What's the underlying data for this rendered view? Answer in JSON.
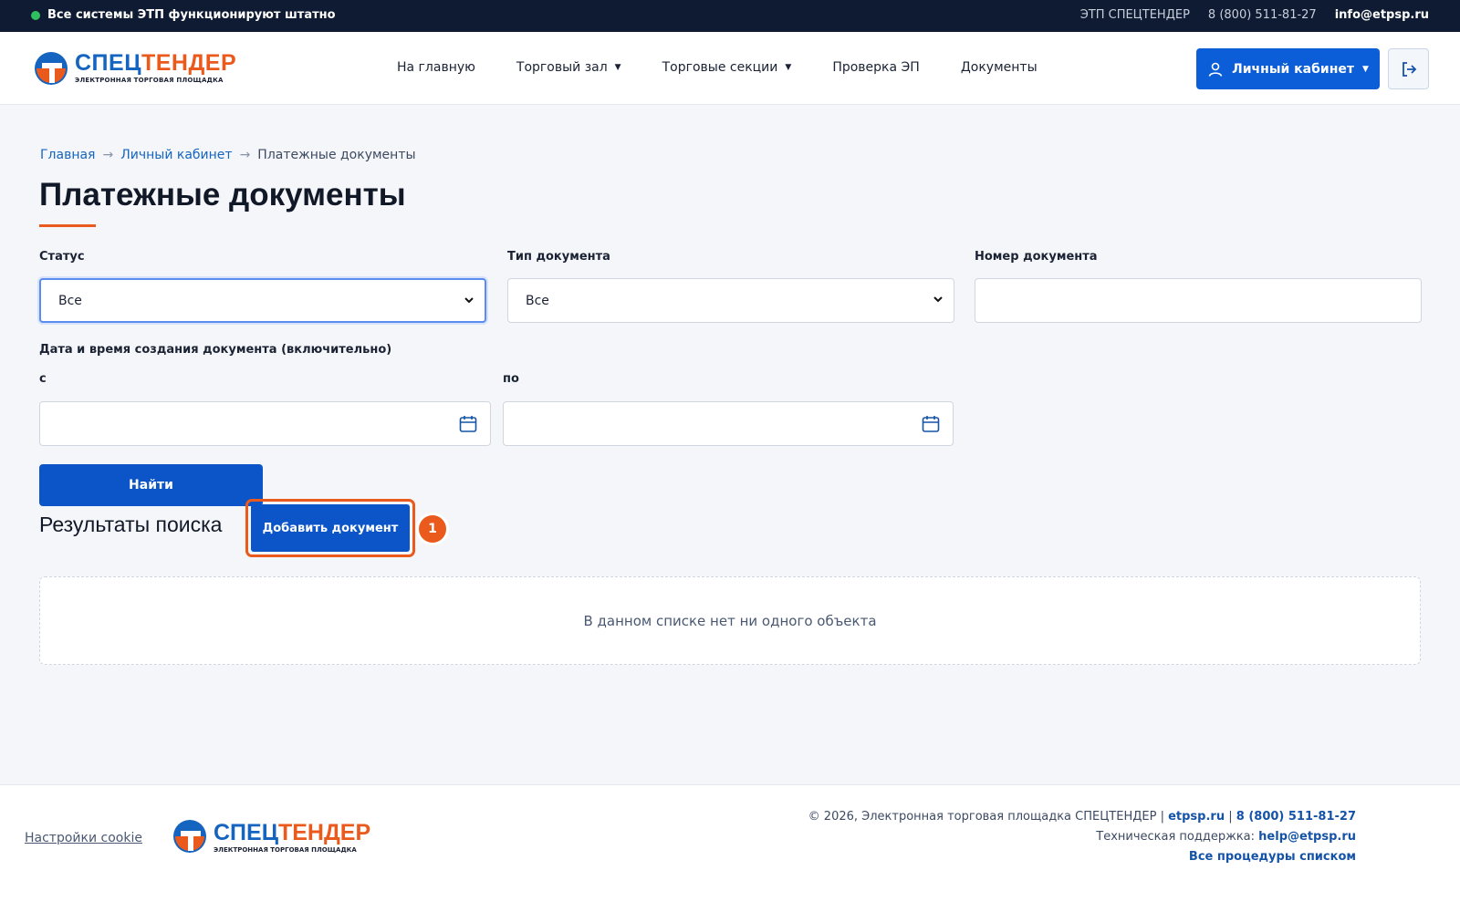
{
  "topbar": {
    "status": "Все системы ЭТП функционируют штатно",
    "brand": "ЭТП СПЕЦТЕНДЕР",
    "phone": "8 (800) 511-81-27",
    "email": "info@etpsp.ru"
  },
  "header": {
    "logo_part1": "СПЕЦ",
    "logo_part2": "ТЕНДЕР",
    "logo_tagline": "ЭЛЕКТРОННАЯ ТОРГОВАЯ ПЛОЩАДКА",
    "nav": [
      {
        "label": "На главную"
      },
      {
        "label": "Торговый зал"
      },
      {
        "label": "Торговые секции"
      },
      {
        "label": "Проверка ЭП"
      },
      {
        "label": "Документы"
      }
    ],
    "cabinet_label": "Личный кабинет"
  },
  "breadcrumbs": [
    "Главная",
    "Личный кабинет",
    "Платежные документы"
  ],
  "page_title": "Платежные документы",
  "filters": {
    "status_label": "Статус",
    "status_value": "Все",
    "doc_type_label": "Тип документа",
    "doc_type_value": "Все",
    "doc_number_label": "Номер документа",
    "doc_number_value": "",
    "date_group_label": "Дата и время создания документа (включительно)",
    "date_from_label": "с",
    "date_to_label": "по",
    "date_from_value": "",
    "date_to_value": "",
    "find_label": "Найти"
  },
  "results": {
    "title": "Результаты поиска",
    "add_label": "Добавить документ",
    "marker": "1",
    "empty_text": "В данном списке нет ни одного объекта"
  },
  "footer": {
    "cookie_label": "Настройки cookie",
    "copyright": "© 2026, Электронная торговая площадка СПЕЦТЕНДЕР |",
    "site": "etpsp.ru",
    "sep": "|",
    "phone": "8 (800) 511-81-27",
    "support_label": "Техническая поддержка:",
    "support_email": "help@etpsp.ru",
    "all_procedures": "Все процедуры списком"
  },
  "colors": {
    "primary": "#0b55c8",
    "accent": "#ea5a1c",
    "topbar": "#0f1b33",
    "ok": "#2fbf5f"
  }
}
